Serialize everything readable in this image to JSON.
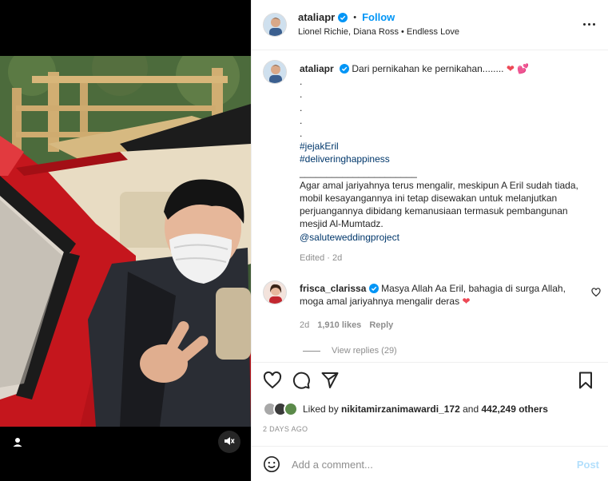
{
  "post": {
    "author": "ataliapr",
    "follow_label": "Follow",
    "separator": "•",
    "music": "Lionel Richie, Diana Ross • Endless Love"
  },
  "caption": {
    "author": "ataliapr",
    "first_line": "Dari pernikahan ke pernikahan........",
    "dots": [
      ".",
      ".",
      ".",
      ".",
      "."
    ],
    "hashtags": [
      "#jejakEril",
      "#deliveringhappiness"
    ],
    "divider": "______________________",
    "body": "Agar amal jariyahnya terus mengalir, meskipun A Eril sudah tiada, mobil kesayangannya ini tetap disewakan untuk melanjutkan perjuangannya dibidang kemanusiaan termasuk pembangunan mesjid Al-Mumtadz.",
    "mention": "@saluteweddingproject",
    "edited": "Edited · 2d"
  },
  "comment": {
    "author": "frisca_clarissa",
    "text": "Masya Allah Aa Eril, bahagia di surga Allah, moga amal jariyahnya mengalir deras",
    "age": "2d",
    "likes": "1,910 likes",
    "reply_label": "Reply",
    "view_replies": "View replies (29)"
  },
  "engagement": {
    "liked_prefix": "Liked by",
    "liked_user": "nikitamirzanimawardi_172",
    "liked_and": "and",
    "liked_others": "442,249 others",
    "date": "2 DAYS AGO"
  },
  "composer": {
    "placeholder": "Add a comment...",
    "post_label": "Post"
  },
  "icons": {
    "heart": "heart-icon",
    "comment": "comment-icon",
    "share": "paper-plane-icon",
    "save": "bookmark-icon",
    "emoji": "smiley-icon",
    "more": "more-horizontal-icon",
    "verified": "verified-badge-icon",
    "mute": "speaker-muted-icon",
    "user_tag": "user-tag-icon"
  },
  "colors": {
    "link_blue": "#0095f6",
    "hashtag": "#00376b",
    "heart_red": "#ed4956",
    "muted": "#8e8e8e",
    "post_disabled": "#b2dffc"
  }
}
